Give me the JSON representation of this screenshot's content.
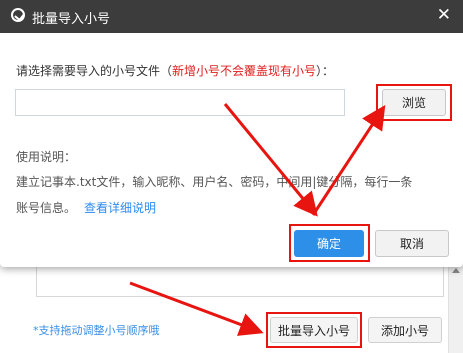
{
  "background": {
    "tip": "*支持拖动调整小号顺序哦",
    "batch_import_button": "批量导入小号",
    "add_button": "添加小号"
  },
  "dialog": {
    "title": "批量导入小号",
    "prompt": "请选择需要导入的小号文件（",
    "prompt_warning": "新增小号不会覆盖现有小号",
    "prompt_end": "）：",
    "file_input_value": "",
    "browse_button": "浏览",
    "usage_title": "使用说明：",
    "usage_line1": "建立记事本.txt文件，输入昵称、用户名、密码，中间用|键分隔，每行一条",
    "usage_line2": "账号信息。",
    "details_link": "查看详细说明",
    "ok_button": "确定",
    "cancel_button": "取消"
  },
  "colors": {
    "titlebar": "#3c3c3c",
    "primary": "#2e8fe8",
    "warning": "#e02020",
    "highlight": "#e8140f",
    "link": "#2d8cf0"
  }
}
